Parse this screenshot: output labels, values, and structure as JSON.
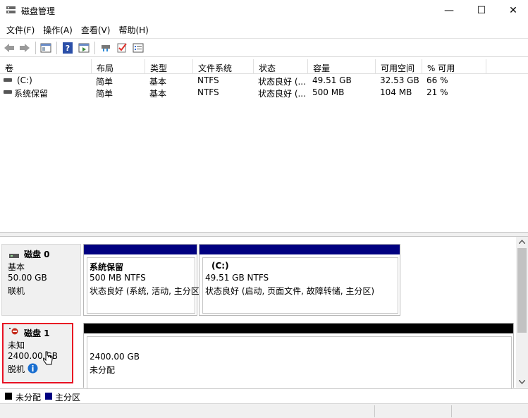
{
  "window": {
    "title": "磁盘管理",
    "minimize_glyph": "—",
    "maximize_glyph": "☐",
    "close_glyph": "✕"
  },
  "menu": [
    "文件(F)",
    "操作(A)",
    "查看(V)",
    "帮助(H)"
  ],
  "toolbar": {
    "icons": [
      "back-icon",
      "forward-icon",
      "show-hide-console-tree-icon",
      "help-icon",
      "action-pane-icon",
      "connect-disk-icon",
      "check-icon",
      "properties-list-icon"
    ]
  },
  "volume_table": {
    "columns": [
      "卷",
      "布局",
      "类型",
      "文件系统",
      "状态",
      "容量",
      "可用空间",
      "% 可用"
    ],
    "rows": [
      [
        "(C:)",
        "简单",
        "基本",
        "NTFS",
        "状态良好 (...",
        "49.51 GB",
        "32.53 GB",
        "66 %"
      ],
      [
        "系统保留",
        "简单",
        "基本",
        "NTFS",
        "状态良好 (...",
        "500 MB",
        "104 MB",
        "21 %"
      ]
    ]
  },
  "disks": [
    {
      "title": "磁盘 0",
      "type": "基本",
      "size": "50.00 GB",
      "state": "联机",
      "partitions": [
        {
          "name": "系统保留",
          "size_fs": "500 MB NTFS",
          "status": "状态良好 (系统, 活动, 主分区)"
        },
        {
          "name": "(C:)",
          "size_fs": "49.51 GB NTFS",
          "status": "状态良好 (启动, 页面文件, 故障转储, 主分区)"
        }
      ]
    },
    {
      "title": "磁盘 1",
      "type": "未知",
      "size": "2400.00 GB",
      "state": "脱机",
      "partitions": [
        {
          "size": "2400.00 GB",
          "status": "未分配"
        }
      ]
    }
  ],
  "legend": [
    {
      "label": "未分配",
      "color": "#000000"
    },
    {
      "label": "主分区",
      "color": "#000080"
    }
  ],
  "colors": {
    "primary_partition": "#000080",
    "unallocated": "#000000",
    "highlight_border": "#e81123",
    "info": "#1a6fd0"
  }
}
